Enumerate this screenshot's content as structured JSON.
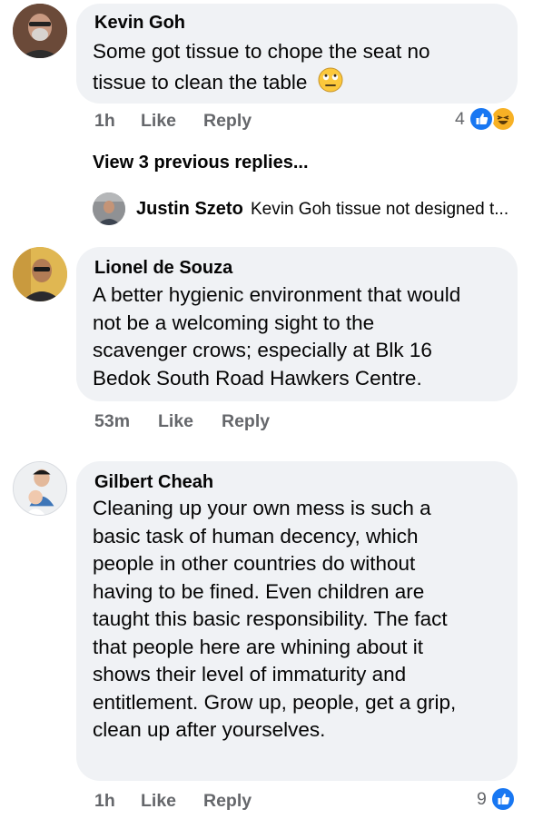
{
  "comments": [
    {
      "author": "Kevin Goh",
      "text_line1": "Some got tissue to chope the seat no",
      "text_line2": "tissue to clean the table",
      "emoji": "rolling-eyes-emoji",
      "time": "1h",
      "like_label": "Like",
      "reply_label": "Reply",
      "reaction_count": "4"
    },
    {
      "author": "Lionel de Souza",
      "text_lines": [
        "A better hygienic environment that would",
        "not be a welcoming sight to the",
        "scavenger crows; especially at Blk 16",
        "Bedok South Road Hawkers Centre."
      ],
      "time": "53m",
      "like_label": "Like",
      "reply_label": "Reply"
    },
    {
      "author": "Gilbert Cheah",
      "text_lines": [
        "Cleaning up your own mess is such a",
        "basic task of human decency, which",
        "people in other countries do without",
        "having to be fined. Even children are",
        "taught this basic responsibility. The fact",
        "that people here are whining about it",
        "shows their level of immaturity and",
        "entitlement. Grow up, people, get a grip,",
        "clean up after yourselves."
      ],
      "time": "1h",
      "like_label": "Like",
      "reply_label": "Reply",
      "reaction_count": "9"
    }
  ],
  "replies": {
    "view_previous": "View 3 previous replies...",
    "latest_author": "Justin Szeto",
    "latest_preview": "Kevin Goh tissue not designed t..."
  }
}
